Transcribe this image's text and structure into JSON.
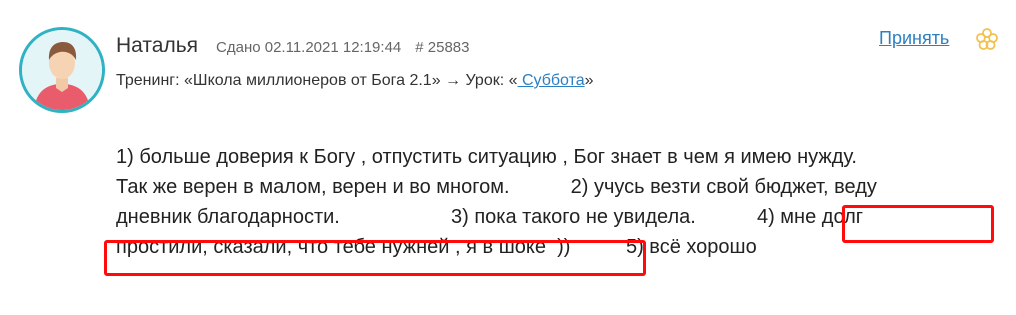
{
  "header": {
    "author": "Наталья",
    "submitted": "Сдано 02.11.2021 12:19:44",
    "number": "# 25883",
    "accept_label": "Принять"
  },
  "lesson": {
    "prefix": "Тренинг: «Школа миллионеров от Бога 2.1» → Урок: «",
    "link": " Суббота",
    "suffix": "»"
  },
  "answer": {
    "line1": "1) больше доверия к Богу , отпустить ситуацию , Бог знает в чем я имею нужду.",
    "line2": "Так же верен в малом, верен и во многом.           2) учусь везти свой бюджет, веду",
    "line3": "дневник благодарности.                    3) пока такого не увидела.           4) мне долг",
    "line4": "простили, сказали, что тебе нужней , я в шоке  ))          5) всё хорошо"
  },
  "icons": {
    "avatar": "user-avatar",
    "flower": "flower-icon"
  },
  "colors": {
    "link": "#2b7fc3",
    "highlight": "#ff0b0b",
    "avatar_ring": "#2fb2c4",
    "flower": "#f2c14e"
  }
}
